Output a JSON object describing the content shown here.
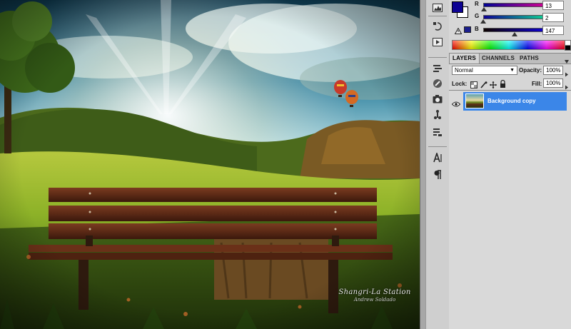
{
  "color_panel": {
    "r_label": "R",
    "g_label": "G",
    "b_label": "B",
    "r_value": "13",
    "g_value": "2",
    "b_value": "147",
    "foreground_color": "#0d0293",
    "background_color": "#ffffff"
  },
  "tabs": [
    {
      "label": "LAYERS",
      "active": true
    },
    {
      "label": "CHANNELS",
      "active": false
    },
    {
      "label": "PATHS",
      "active": false
    }
  ],
  "layers_panel": {
    "blend_mode": "Normal",
    "opacity_label": "Opacity:",
    "opacity_value": "100%",
    "lock_label": "Lock:",
    "fill_label": "Fill:",
    "fill_value": "100%",
    "layers": [
      {
        "name": "Background copy",
        "visible": true,
        "selected": true
      }
    ]
  },
  "watermark": {
    "line1": "Shangri-La Station",
    "line2": "Andrew Soldado"
  },
  "colors": {
    "selection": "#3b86e8",
    "panel_bg": "#d6d6d6"
  }
}
